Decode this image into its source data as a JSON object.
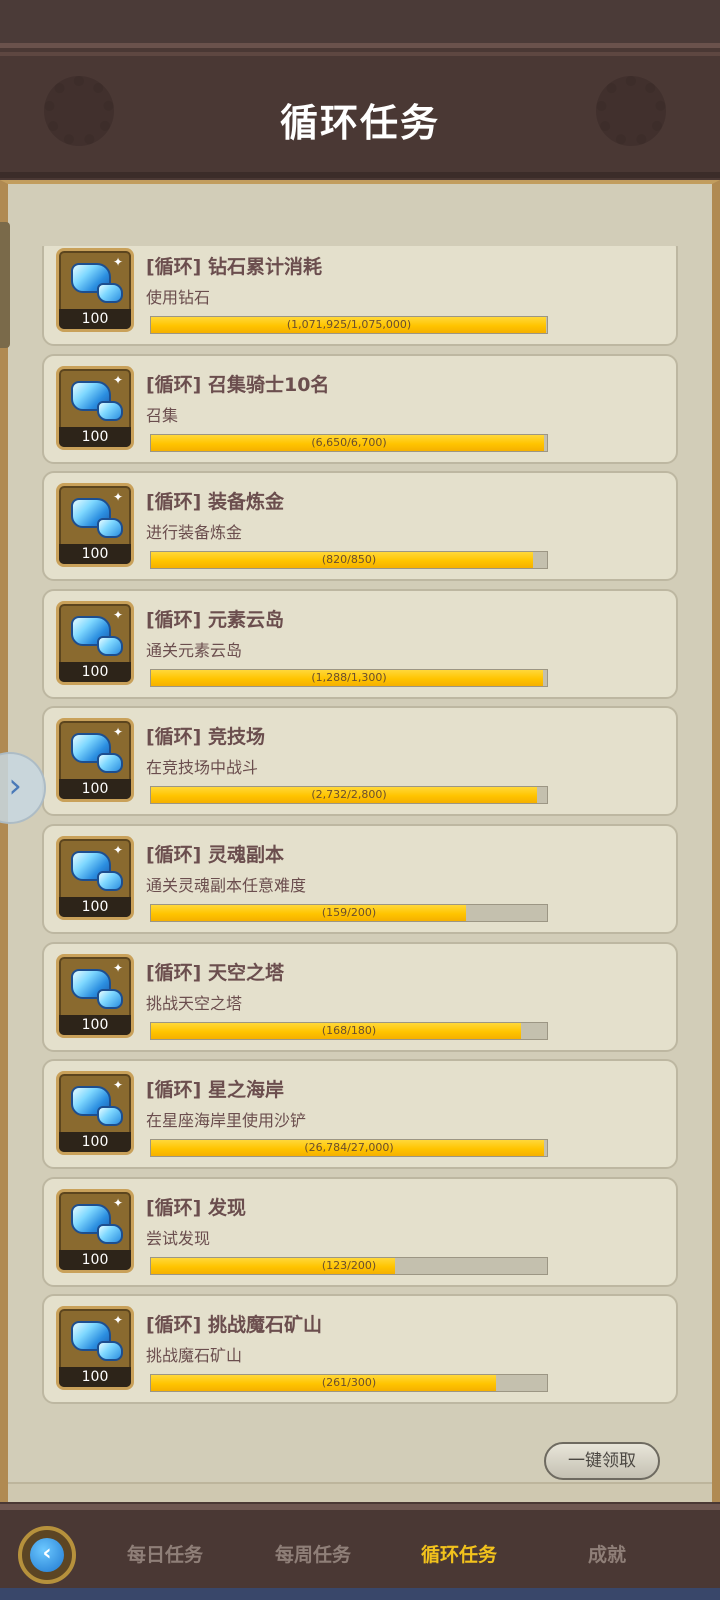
{
  "header": {
    "title": "循环任务"
  },
  "tasks": [
    {
      "name": "[循环] 钻石累计消耗",
      "desc": "使用钻石",
      "reward": "100",
      "progress_text": "(1,071,925/1,075,000)",
      "current": 1071925,
      "total": 1075000
    },
    {
      "name": "[循环] 召集骑士10名",
      "desc": "召集",
      "reward": "100",
      "progress_text": "(6,650/6,700)",
      "current": 6650,
      "total": 6700
    },
    {
      "name": "[循环] 装备炼金",
      "desc": "进行装备炼金",
      "reward": "100",
      "progress_text": "(820/850)",
      "current": 820,
      "total": 850
    },
    {
      "name": "[循环] 元素云岛",
      "desc": "通关元素云岛",
      "reward": "100",
      "progress_text": "(1,288/1,300)",
      "current": 1288,
      "total": 1300
    },
    {
      "name": "[循环] 竞技场",
      "desc": "在竞技场中战斗",
      "reward": "100",
      "progress_text": "(2,732/2,800)",
      "current": 2732,
      "total": 2800
    },
    {
      "name": "[循环] 灵魂副本",
      "desc": "通关灵魂副本任意难度",
      "reward": "100",
      "progress_text": "(159/200)",
      "current": 159,
      "total": 200
    },
    {
      "name": "[循环] 天空之塔",
      "desc": "挑战天空之塔",
      "reward": "100",
      "progress_text": "(168/180)",
      "current": 168,
      "total": 180
    },
    {
      "name": "[循环] 星之海岸",
      "desc": "在星座海岸里使用沙铲",
      "reward": "100",
      "progress_text": "(26,784/27,000)",
      "current": 26784,
      "total": 27000
    },
    {
      "name": "[循环] 发现",
      "desc": "尝试发现",
      "reward": "100",
      "progress_text": "(123/200)",
      "current": 123,
      "total": 200
    },
    {
      "name": "[循环] 挑战魔石矿山",
      "desc": "挑战魔石矿山",
      "reward": "100",
      "progress_text": "(261/300)",
      "current": 261,
      "total": 300
    }
  ],
  "claim_all_label": "一键领取",
  "bottom_tabs": [
    "每日任务",
    "每周任务",
    "循环任务",
    "成就"
  ],
  "active_tab_index": 2,
  "icons": {
    "back": "back-arrow-icon",
    "side": "chevron-right-icon",
    "reward": "diamond-icon"
  },
  "colors": {
    "progress_fill": "#ffc400",
    "active_tab": "#f2c21c"
  }
}
